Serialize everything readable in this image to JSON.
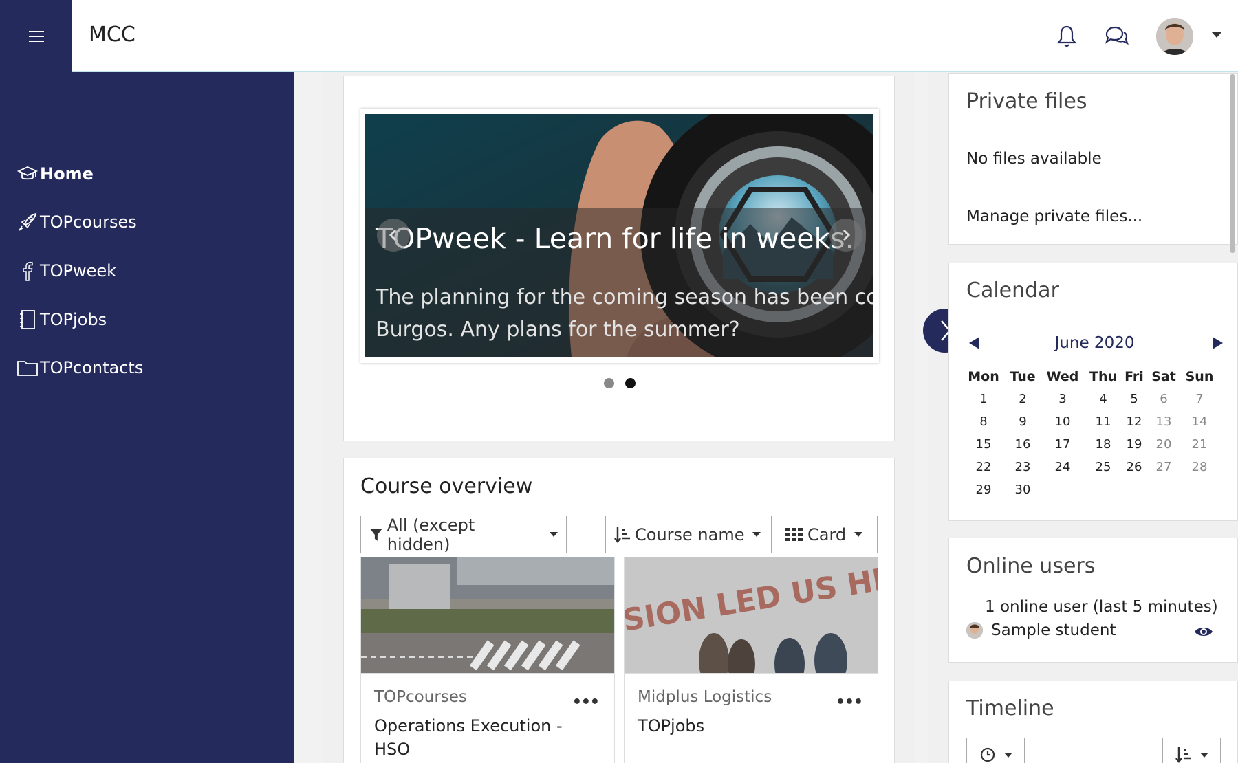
{
  "navbar": {
    "site_name": "MCC",
    "menu_icon": "hamburger-icon",
    "notifications_icon": "bell-icon",
    "messages_icon": "chat-icon",
    "user_avatar": "user-avatar"
  },
  "sidebar": {
    "items": [
      {
        "label": "Home",
        "icon": "graduation-cap-icon",
        "active": true
      },
      {
        "label": "TOPcourses",
        "icon": "rocket-icon"
      },
      {
        "label": "TOPweek",
        "icon": "facebook-icon"
      },
      {
        "label": "TOPjobs",
        "icon": "notebook-icon"
      },
      {
        "label": "TOPcontacts",
        "icon": "folder-icon"
      }
    ]
  },
  "carousel": {
    "title": "TOPweek - Learn for life in weeks.",
    "text_line1": "The planning for the coming season has been comp",
    "text_line2": "Burgos. Any plans for the summer?",
    "active_slide": 2,
    "slide_count": 2
  },
  "course_overview": {
    "title": "Course overview",
    "filter_label": "All (except hidden)",
    "sort_label": "Course name",
    "view_label": "Card",
    "courses": [
      {
        "category": "TOPcourses",
        "name": "Operations Execution - HSO"
      },
      {
        "category": "Midplus Logistics",
        "name": "TOPjobs"
      }
    ],
    "card_image_2_text": "SION LED US HI"
  },
  "private_files": {
    "title": "Private files",
    "empty_text": "No files available",
    "manage_link": "Manage private files..."
  },
  "calendar": {
    "title": "Calendar",
    "month": "June 2020",
    "days_of_week": [
      "Mon",
      "Tue",
      "Wed",
      "Thu",
      "Fri",
      "Sat",
      "Sun"
    ],
    "weeks": [
      [
        "1",
        "2",
        "3",
        "4",
        "5",
        "6",
        "7"
      ],
      [
        "8",
        "9",
        "10",
        "11",
        "12",
        "13",
        "14"
      ],
      [
        "15",
        "16",
        "17",
        "18",
        "19",
        "20",
        "21"
      ],
      [
        "22",
        "23",
        "24",
        "25",
        "26",
        "27",
        "28"
      ],
      [
        "29",
        "30",
        "",
        "",
        "",
        "",
        ""
      ]
    ]
  },
  "online_users": {
    "title": "Online users",
    "summary": "1 online user (last 5 minutes)",
    "users": [
      {
        "name": "Sample student"
      }
    ]
  },
  "timeline": {
    "title": "Timeline"
  },
  "colors": {
    "brand_dark": "#242a5c",
    "sidebar_text": "#ffffff"
  }
}
